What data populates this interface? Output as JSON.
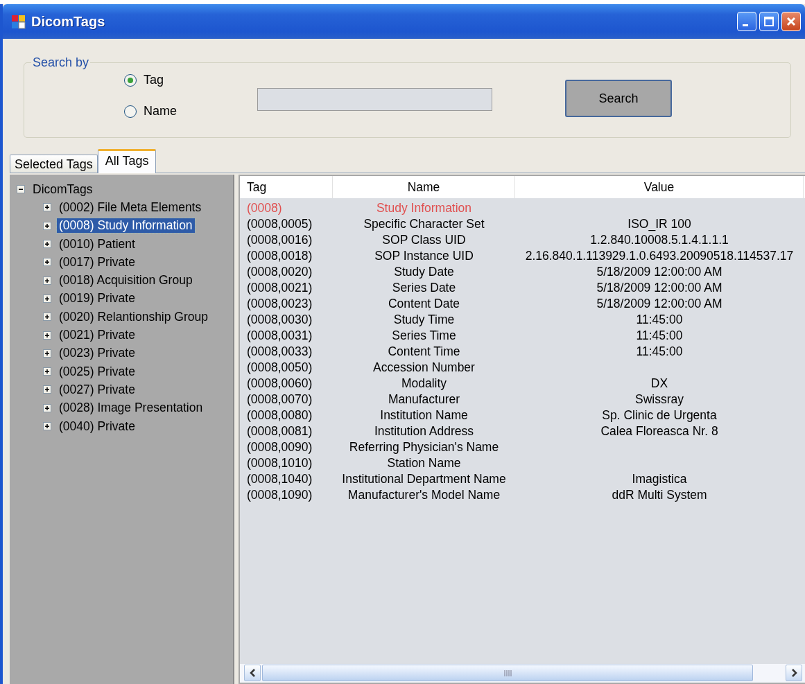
{
  "window": {
    "title": "DicomTags"
  },
  "search": {
    "legend": "Search by",
    "options": [
      {
        "label": "Tag",
        "selected": true
      },
      {
        "label": "Name",
        "selected": false
      }
    ],
    "button": "Search"
  },
  "tabs": [
    {
      "label": "Selected Tags",
      "selected": false
    },
    {
      "label": "All Tags",
      "selected": true
    }
  ],
  "tree": {
    "label": "DicomTags",
    "expanded": true,
    "selected": false,
    "children": [
      {
        "label": "(0002) File Meta Elements",
        "expanded": false,
        "selected": false
      },
      {
        "label": "(0008) Study Information",
        "expanded": false,
        "selected": true
      },
      {
        "label": "(0010) Patient",
        "expanded": false,
        "selected": false
      },
      {
        "label": "(0017) Private",
        "expanded": false,
        "selected": false
      },
      {
        "label": "(0018) Acquisition Group",
        "expanded": false,
        "selected": false
      },
      {
        "label": "(0019) Private",
        "expanded": false,
        "selected": false
      },
      {
        "label": "(0020) Relantionship Group",
        "expanded": false,
        "selected": false
      },
      {
        "label": "(0021) Private",
        "expanded": false,
        "selected": false
      },
      {
        "label": "(0023) Private",
        "expanded": false,
        "selected": false
      },
      {
        "label": "(0025) Private",
        "expanded": false,
        "selected": false
      },
      {
        "label": "(0027) Private",
        "expanded": false,
        "selected": false
      },
      {
        "label": "(0028) Image Presentation",
        "expanded": false,
        "selected": false
      },
      {
        "label": "(0040) Private",
        "expanded": false,
        "selected": false
      }
    ]
  },
  "table": {
    "columns": [
      "Tag",
      "Name",
      "Value"
    ],
    "rows": [
      {
        "kind": "group",
        "tag": "(0008)",
        "name": "Study Information"
      },
      {
        "kind": "element",
        "tag": "(0008,0005)",
        "name": "Specific Character Set",
        "value": "ISO_IR 100"
      },
      {
        "kind": "element",
        "tag": "(0008,0016)",
        "name": "SOP Class UID",
        "value": "1.2.840.10008.5.1.4.1.1.1"
      },
      {
        "kind": "element",
        "tag": "(0008,0018)",
        "name": "SOP Instance UID",
        "value": "2.16.840.1.113929.1.0.6493.20090518.114537.17"
      },
      {
        "kind": "element",
        "tag": "(0008,0020)",
        "name": "Study Date",
        "value": "5/18/2009 12:00:00 AM"
      },
      {
        "kind": "element",
        "tag": "(0008,0021)",
        "name": "Series Date",
        "value": "5/18/2009 12:00:00 AM"
      },
      {
        "kind": "element",
        "tag": "(0008,0023)",
        "name": "Content Date",
        "value": "5/18/2009 12:00:00 AM"
      },
      {
        "kind": "element",
        "tag": "(0008,0030)",
        "name": "Study Time",
        "value": "11:45:00"
      },
      {
        "kind": "element",
        "tag": "(0008,0031)",
        "name": "Series Time",
        "value": "11:45:00"
      },
      {
        "kind": "element",
        "tag": "(0008,0033)",
        "name": "Content Time",
        "value": "11:45:00"
      },
      {
        "kind": "element",
        "tag": "(0008,0050)",
        "name": "Accession Number"
      },
      {
        "kind": "element",
        "tag": "(0008,0060)",
        "name": "Modality",
        "value": "DX"
      },
      {
        "kind": "element",
        "tag": "(0008,0070)",
        "name": "Manufacturer",
        "value": "Swissray"
      },
      {
        "kind": "element",
        "tag": "(0008,0080)",
        "name": "Institution Name",
        "value": "Sp. Clinic de Urgenta"
      },
      {
        "kind": "element",
        "tag": "(0008,0081)",
        "name": "Institution Address",
        "value": "Calea Floreasca Nr. 8"
      },
      {
        "kind": "element",
        "tag": "(0008,0090)",
        "name": "Referring Physician's Name"
      },
      {
        "kind": "element",
        "tag": "(0008,1010)",
        "name": "Station Name"
      },
      {
        "kind": "element",
        "tag": "(0008,1040)",
        "name": "Institutional Department Name",
        "value": "Imagistica"
      },
      {
        "kind": "element",
        "tag": "(0008,1090)",
        "name": "Manufacturer's Model Name",
        "value": "ddR Multi System"
      }
    ]
  }
}
